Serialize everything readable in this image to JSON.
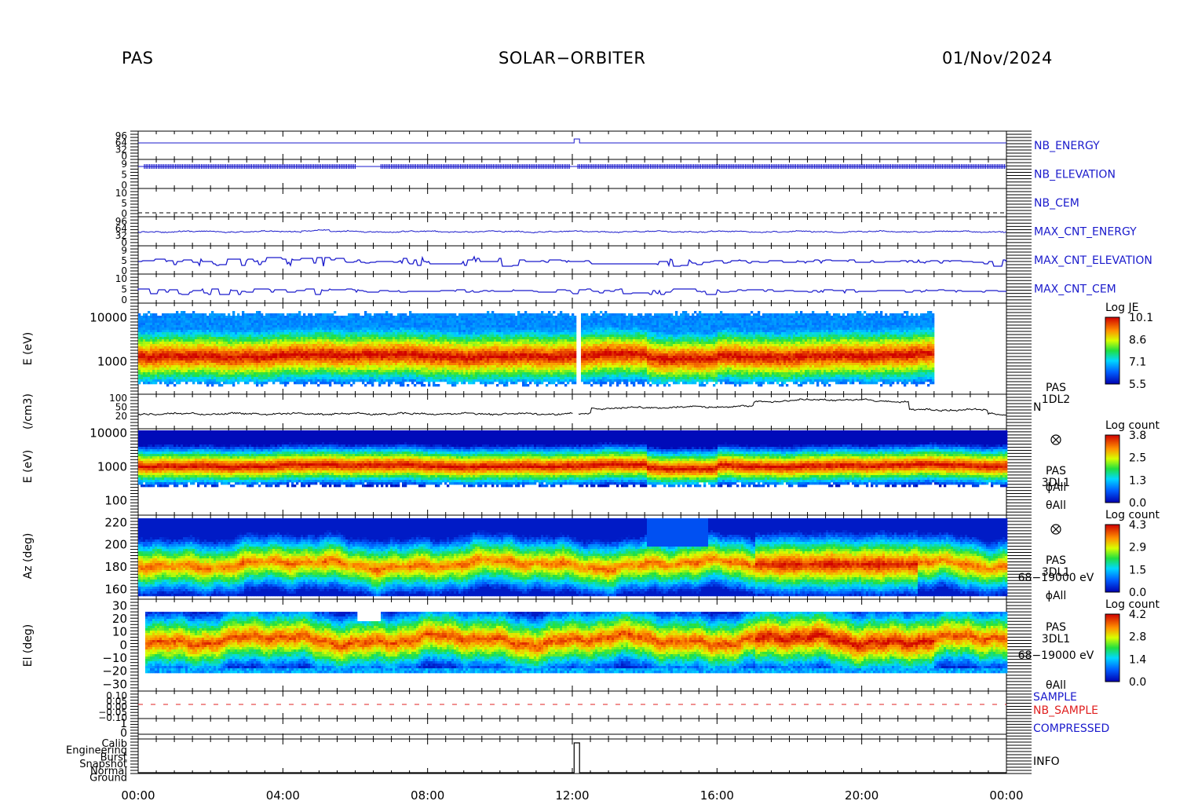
{
  "header": {
    "left": "PAS",
    "center": "SOLAR−ORBITER",
    "right": "01/Nov/2024"
  },
  "colors": {
    "line_blue": "#1a1acc",
    "sample_red": "#e02020"
  },
  "x_axis": {
    "ticks": [
      "00:00",
      "04:00",
      "08:00",
      "12:00",
      "16:00",
      "20:00",
      "00:00"
    ],
    "hours": [
      0,
      4,
      8,
      12,
      16,
      20,
      24
    ]
  },
  "hk_panels": [
    {
      "label": "NB_ENERGY",
      "color": "#1a1acc",
      "ticks": [
        "96",
        "64",
        "32",
        "0"
      ]
    },
    {
      "label": "NB_ELEVATION",
      "color": "#1a1acc",
      "ticks": [
        "9",
        "5",
        "0"
      ]
    },
    {
      "label": "NB_CEM",
      "color": "#1a1acc",
      "ticks": [
        "10",
        "5",
        "0"
      ]
    },
    {
      "label": "MAX_CNT_ENERGY",
      "color": "#1a1acc",
      "ticks": [
        "96",
        "64",
        "32",
        "0"
      ]
    },
    {
      "label": "MAX_CNT_ELEVATION",
      "color": "#1a1acc",
      "ticks": [
        "9",
        "5",
        "0"
      ]
    },
    {
      "label": "MAX_CNT_CEM",
      "color": "#1a1acc",
      "ticks": [
        "10",
        "5",
        "0"
      ]
    }
  ],
  "spec_panels": {
    "energy_1dl2": {
      "ylabel": "E  (eV)",
      "ticks": [
        "10000",
        "1000"
      ],
      "cbar_title": "Log JE",
      "cbar_ticks": [
        "10.1",
        "8.6",
        "7.1",
        "5.5"
      ]
    },
    "density": {
      "ylabel": "(/cm3)",
      "ticks": [
        "100",
        "50",
        "20"
      ],
      "right_lines": [
        "PAS",
        "1DL2"
      ],
      "right_tag": "N"
    },
    "energy_3dl1": {
      "ylabel": "E  (eV)",
      "ticks": [
        "10000",
        "1000",
        "100"
      ],
      "right_lines": [
        "PAS",
        "3DL1",
        "ϕAll",
        "θAll"
      ],
      "cbar_title": "Log count",
      "cbar_ticks": [
        "3.8",
        "2.5",
        "1.3",
        "0.0"
      ]
    },
    "azimuth": {
      "ylabel": "Az (deg)",
      "ticks": [
        "220",
        "200",
        "180",
        "160"
      ],
      "right_lines": [
        "PAS",
        "3DL1",
        "68−19000 eV",
        "ϕAll"
      ],
      "cbar_title": "Log count",
      "cbar_ticks": [
        "4.3",
        "2.9",
        "1.5",
        "0.0"
      ]
    },
    "elevation": {
      "ylabel": "El (deg)",
      "ticks": [
        "30",
        "20",
        "10",
        "0",
        "−10",
        "−20",
        "−30"
      ],
      "right_lines": [
        "PAS",
        "3DL1",
        "68−19000 eV",
        "θAll"
      ],
      "cbar_title": "Log count",
      "cbar_ticks": [
        "4.2",
        "2.8",
        "1.4",
        "0.0"
      ]
    }
  },
  "bottom_panels": {
    "sample": {
      "labels": [
        "SAMPLE",
        "NB_SAMPLE"
      ],
      "label_colors": [
        "#1a1acc",
        "#e02020"
      ],
      "ticks": [
        "0.10",
        "0.05",
        "0.00",
        "−0.05",
        "−0.10"
      ]
    },
    "compressed": {
      "label": "COMPRESSED",
      "ticks": [
        "1",
        "0"
      ]
    },
    "info": {
      "label": "INFO",
      "ticks": [
        "Calib",
        "Engineering",
        "Burst",
        "Snapshot",
        "Normal",
        "Ground"
      ]
    }
  }
}
